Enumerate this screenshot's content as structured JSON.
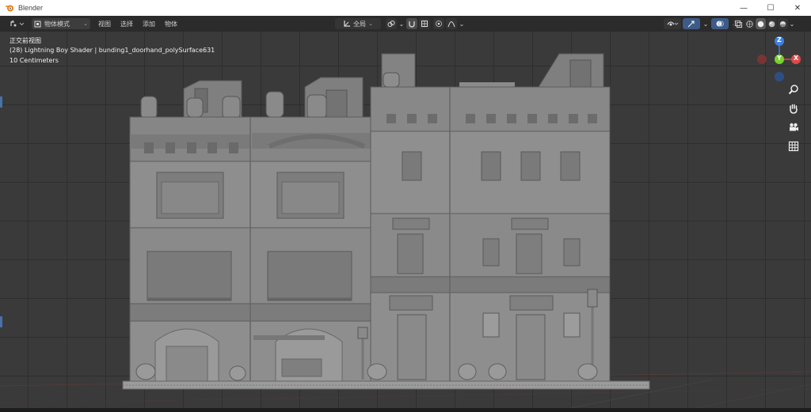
{
  "window": {
    "title": "Blender",
    "minimize_glyph": "—",
    "maximize_glyph": "☐",
    "close_glyph": "✕"
  },
  "header": {
    "mode": "物体模式",
    "menus": [
      "视图",
      "选择",
      "添加",
      "物体"
    ],
    "transform_orientation": "全局"
  },
  "viewport": {
    "view_name": "正交前视图",
    "object_info": "(28) Lightning Boy Shader | bunding1_doorhand_polySurface631",
    "grid_scale": "10 Centimeters"
  },
  "gizmo": {
    "z_label": "Z",
    "y_label": "Y",
    "x_label": "X"
  },
  "colors": {
    "axis_x": "#e04848",
    "axis_y": "#7ad12a",
    "axis_z": "#3f7fe0",
    "header_bg": "#2b2b2b",
    "viewport_bg": "#3a3a3a"
  },
  "icons": [
    "blender-logo-icon",
    "editor-type-icon",
    "object-mode-icon",
    "pivot-icon",
    "snap-icon",
    "proportional-icon",
    "visibility-icon",
    "gizmo-toggle-icon",
    "overlay-icon",
    "xray-icon",
    "zoom-icon",
    "hand-pan-icon",
    "camera-icon",
    "grid-icon"
  ]
}
